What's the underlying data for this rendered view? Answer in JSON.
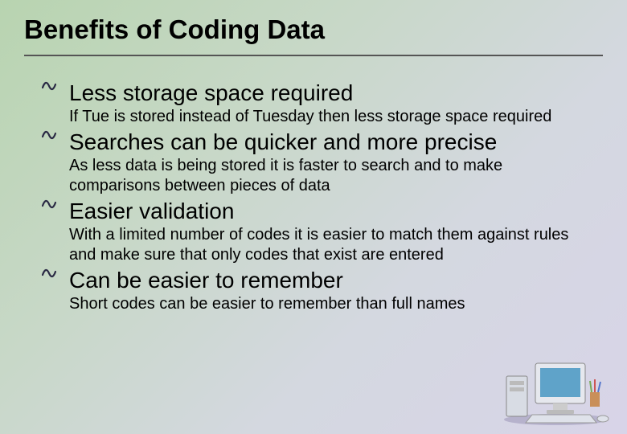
{
  "title": "Benefits of Coding Data",
  "items": [
    {
      "heading": "Less storage space required",
      "desc": "If Tue is stored instead of Tuesday then less storage space required"
    },
    {
      "heading": "Searches can be quicker and more precise",
      "desc": "As less data is being stored it is faster to search and to make comparisons between pieces of data"
    },
    {
      "heading": "Easier validation",
      "desc": "With a limited number of codes it is easier to match them against rules and make sure that only codes that exist are entered"
    },
    {
      "heading": "Can be easier to remember",
      "desc": "Short codes can be easier to remember than full names"
    }
  ]
}
